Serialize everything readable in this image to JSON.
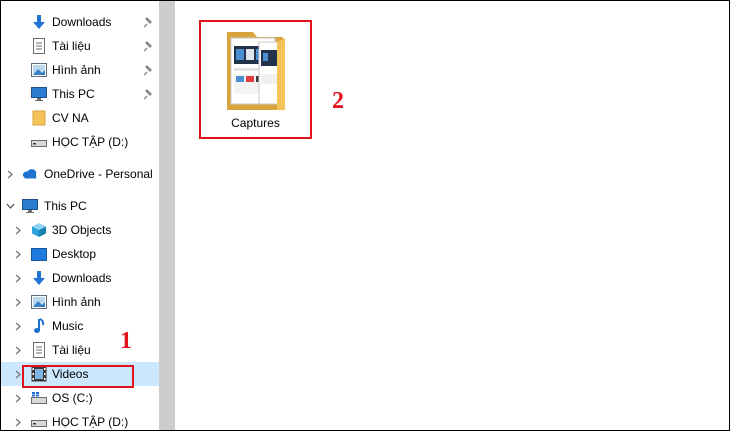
{
  "quick_access": [
    {
      "label": "Downloads",
      "icon": "download-arrow-icon",
      "pinned": true
    },
    {
      "label": "Tài liệu",
      "icon": "document-icon",
      "pinned": true
    },
    {
      "label": "Hình ảnh",
      "icon": "pictures-icon",
      "pinned": true
    },
    {
      "label": "This PC",
      "icon": "computer-icon",
      "pinned": true
    },
    {
      "label": "CV NA",
      "icon": "folder-icon",
      "pinned": false
    },
    {
      "label": "HỌC TẬP (D:)",
      "icon": "drive-icon",
      "pinned": false
    }
  ],
  "onedrive": {
    "label": "OneDrive - Personal",
    "icon": "cloud-icon"
  },
  "this_pc": {
    "label": "This PC",
    "icon": "computer-icon",
    "children": [
      {
        "label": "3D Objects",
        "icon": "cube-icon"
      },
      {
        "label": "Desktop",
        "icon": "desktop-icon"
      },
      {
        "label": "Downloads",
        "icon": "download-arrow-icon"
      },
      {
        "label": "Hình ảnh",
        "icon": "pictures-icon"
      },
      {
        "label": "Music",
        "icon": "music-note-icon"
      },
      {
        "label": "Tài liệu",
        "icon": "document-icon"
      },
      {
        "label": "Videos",
        "icon": "film-icon",
        "selected": true
      },
      {
        "label": "OS (C:)",
        "icon": "windows-drive-icon"
      },
      {
        "label": "HỌC TẬP (D:)",
        "icon": "drive-icon"
      }
    ]
  },
  "content": {
    "items": [
      {
        "label": "Captures",
        "icon": "folder-with-images-icon"
      }
    ]
  },
  "annotations": {
    "step1": "1",
    "step2": "2"
  },
  "colors": {
    "highlight": "#e2131d",
    "selection": "#cce8ff",
    "folder": "#f6c35a"
  }
}
